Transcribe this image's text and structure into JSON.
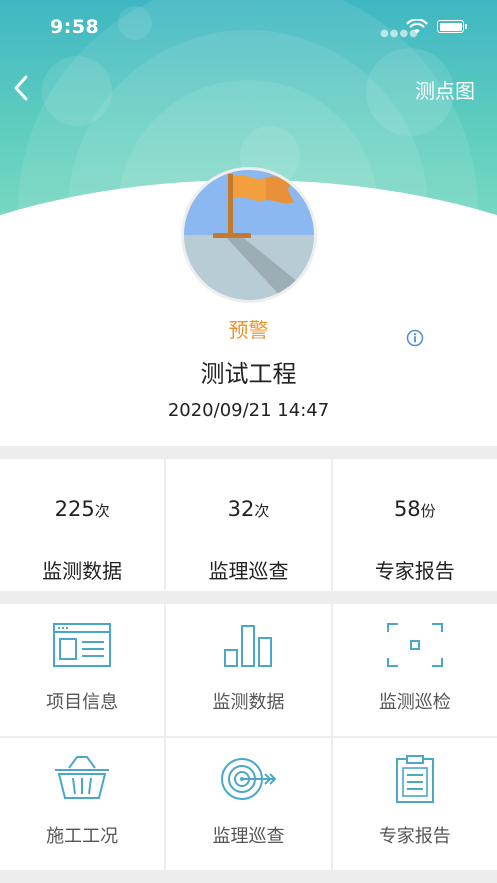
{
  "status_bar": {
    "time": "9:58"
  },
  "nav": {
    "right_link": "测点图"
  },
  "project": {
    "status": "预警",
    "name": "测试工程",
    "datetime": "2020/09/21 14:47"
  },
  "stats": [
    {
      "value": "225",
      "unit": "次",
      "label": "监测数据"
    },
    {
      "value": "32",
      "unit": "次",
      "label": "监理巡查"
    },
    {
      "value": "58",
      "unit": "份",
      "label": "专家报告"
    }
  ],
  "menu": [
    {
      "label": "项目信息",
      "icon": "window-icon"
    },
    {
      "label": "监测数据",
      "icon": "bar-chart-icon"
    },
    {
      "label": "监测巡检",
      "icon": "scan-frame-icon"
    },
    {
      "label": "施工工况",
      "icon": "basket-icon"
    },
    {
      "label": "监理巡查",
      "icon": "target-icon"
    },
    {
      "label": "专家报告",
      "icon": "clipboard-icon"
    }
  ],
  "colors": {
    "header_gradient_top": "#3fb6c3",
    "header_gradient_bottom": "#7fdcc0",
    "status_warning": "#f0932b",
    "icon_accent": "#4aa7c7",
    "flag": "#f2a03d"
  }
}
